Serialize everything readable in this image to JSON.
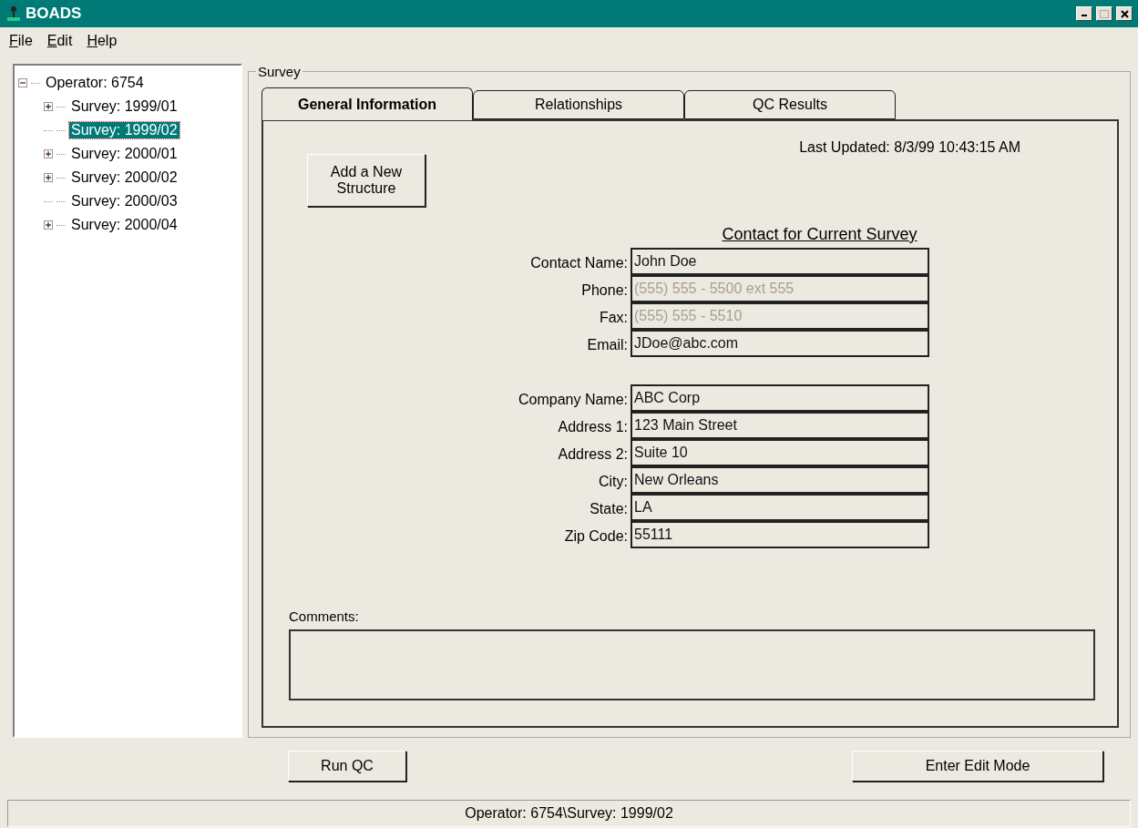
{
  "window": {
    "title": "BOADS"
  },
  "menu": [
    "File",
    "Edit",
    "Help"
  ],
  "tree": {
    "label": "Operator: 6754",
    "expanded": true,
    "children": [
      {
        "label": "Survey: 1999/01",
        "collapsed": true,
        "selected": false
      },
      {
        "label": "Survey: 1999/02",
        "collapsed": false,
        "selected": true
      },
      {
        "label": "Survey: 2000/01",
        "collapsed": true,
        "selected": false
      },
      {
        "label": "Survey: 2000/02",
        "collapsed": true,
        "selected": false
      },
      {
        "label": "Survey: 2000/03",
        "collapsed": false,
        "selected": false
      },
      {
        "label": "Survey: 2000/04",
        "collapsed": true,
        "selected": false
      }
    ]
  },
  "group_title": "Survey",
  "tabs": [
    {
      "label": "General Information",
      "selected": true
    },
    {
      "label": "Relationships",
      "selected": false
    },
    {
      "label": "QC Results",
      "selected": false
    }
  ],
  "last_updated": "Last Updated: 8/3/99 10:43:15 AM",
  "add_button": "Add a New Structure",
  "contact_heading": "Contact for Current Survey",
  "field_groups": [
    [
      {
        "label": "Contact Name:",
        "value": "John Doe",
        "dimmed": false
      },
      {
        "label": "Phone:",
        "value": "(555) 555 - 5500 ext 555",
        "dimmed": true
      },
      {
        "label": "Fax:",
        "value": "(555) 555 - 5510",
        "dimmed": true
      },
      {
        "label": "Email:",
        "value": "JDoe@abc.com",
        "dimmed": false
      }
    ],
    [
      {
        "label": "Company Name:",
        "value": "ABC Corp",
        "dimmed": false
      },
      {
        "label": "Address 1:",
        "value": "123 Main Street",
        "dimmed": false
      },
      {
        "label": "Address 2:",
        "value": "Suite 10",
        "dimmed": false
      },
      {
        "label": "City:",
        "value": "New Orleans",
        "dimmed": false
      },
      {
        "label": "State:",
        "value": "LA",
        "dimmed": false
      },
      {
        "label": "Zip Code:",
        "value": "55111",
        "dimmed": false
      }
    ]
  ],
  "comments_label": "Comments:",
  "buttons": [
    "Run QC",
    "Enter Edit Mode"
  ],
  "status_bar": "Operator: 6754\\Survey: 1999/02"
}
